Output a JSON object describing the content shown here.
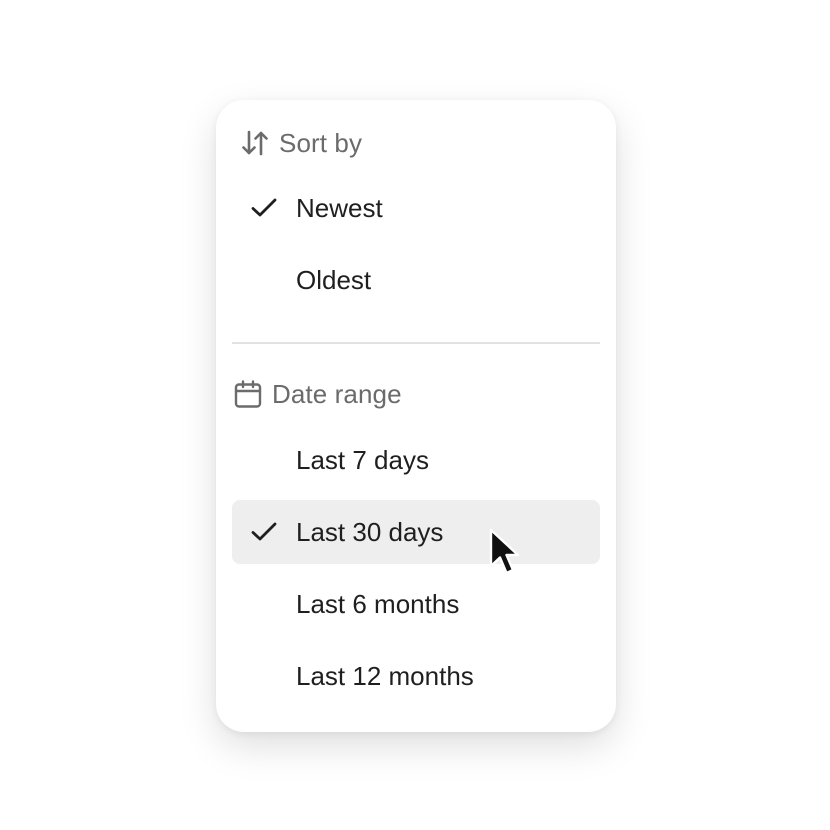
{
  "sort": {
    "header": "Sort by",
    "header_icon": "sort-arrows-icon",
    "items": [
      {
        "label": "Newest",
        "checked": true
      },
      {
        "label": "Oldest",
        "checked": false
      }
    ]
  },
  "date_range": {
    "header": "Date range",
    "header_icon": "calendar-icon",
    "items": [
      {
        "label": "Last 7 days",
        "checked": false,
        "highlighted": false
      },
      {
        "label": "Last 30 days",
        "checked": true,
        "highlighted": true
      },
      {
        "label": "Last 6 months",
        "checked": false,
        "highlighted": false
      },
      {
        "label": "Last 12 months",
        "checked": false,
        "highlighted": false
      }
    ]
  },
  "colors": {
    "text_primary": "#1f1f1f",
    "text_secondary": "#6b6b6b",
    "highlight": "#eeeeee",
    "divider": "#e2e2e2"
  }
}
